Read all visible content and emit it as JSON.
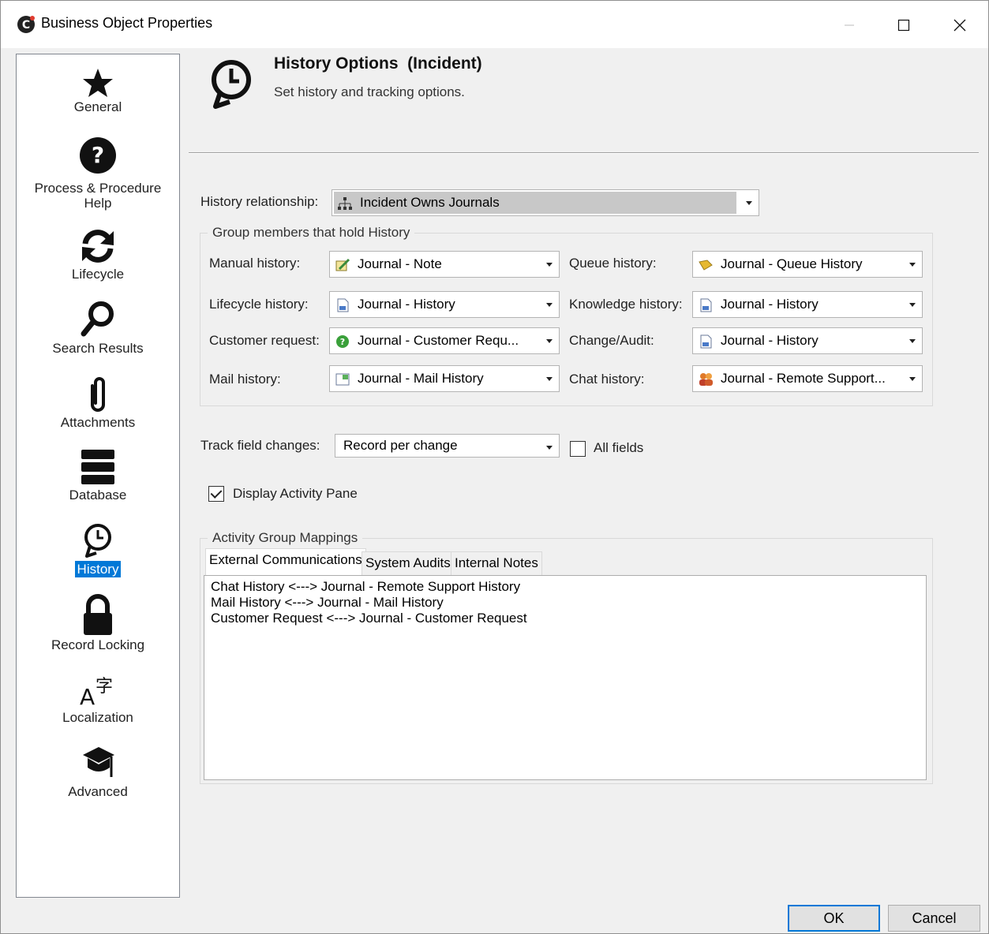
{
  "window": {
    "title": "Business Object Properties",
    "controls": {
      "minimize": "—",
      "maximize": "☐",
      "close": "✕"
    }
  },
  "sidebar": {
    "items": [
      {
        "label": "General",
        "icon": "star-icon",
        "selected": false
      },
      {
        "label": "Process & Procedure",
        "label2": "Help",
        "icon": "question-circle-icon",
        "selected": false
      },
      {
        "label": "Lifecycle",
        "icon": "refresh-icon",
        "selected": false
      },
      {
        "label": "Search Results",
        "icon": "magnifier-icon",
        "selected": false
      },
      {
        "label": "Attachments",
        "icon": "paperclip-icon",
        "selected": false
      },
      {
        "label": "Database",
        "icon": "database-icon",
        "selected": false
      },
      {
        "label": "History",
        "icon": "history-clock-icon",
        "selected": true
      },
      {
        "label": "Record Locking",
        "icon": "padlock-icon",
        "selected": false
      },
      {
        "label": "Localization",
        "icon": "localization-icon",
        "selected": false
      },
      {
        "label": "Advanced",
        "icon": "graduation-cap-icon",
        "selected": false
      }
    ]
  },
  "header": {
    "title": "History Options  (Incident)",
    "subtitle": "Set history and tracking options."
  },
  "history_relationship": {
    "label": "History relationship:",
    "value": "Incident Owns Journals",
    "icon": "relationship-tree-icon"
  },
  "group_members": {
    "title": "Group members that hold History",
    "left": [
      {
        "label": "Manual history:",
        "value": "Journal - Note",
        "icon": "note-pencil-icon"
      },
      {
        "label": "Lifecycle history:",
        "value": "Journal - History",
        "icon": "journal-doc-icon"
      },
      {
        "label": "Customer request:",
        "value": "Journal  -  Customer  Requ...",
        "icon": "green-circle-icon"
      },
      {
        "label": "Mail history:",
        "value": "Journal - Mail History",
        "icon": "mail-doc-icon"
      }
    ],
    "right": [
      {
        "label": "Queue history:",
        "value": "Journal - Queue History",
        "icon": "queue-tag-icon"
      },
      {
        "label": "Knowledge history:",
        "value": "Journal - History",
        "icon": "journal-doc-icon"
      },
      {
        "label": "Change/Audit:",
        "value": "Journal - History",
        "icon": "journal-doc-icon"
      },
      {
        "label": "Chat history:",
        "value": "Journal  -  Remote  Support...",
        "icon": "people-icon"
      }
    ]
  },
  "track_changes": {
    "label": "Track field changes:",
    "value": "Record per change",
    "all_fields_label": "All fields",
    "all_fields_checked": false
  },
  "display_activity_pane": {
    "label": "Display Activity Pane",
    "checked": true
  },
  "activity_mappings": {
    "title": "Activity Group Mappings",
    "tabs": [
      {
        "label": "External Communications",
        "active": true
      },
      {
        "label": "System Audits",
        "active": false
      },
      {
        "label": "Internal Notes",
        "active": false
      }
    ],
    "lines": [
      "Chat History <---> Journal - Remote Support History",
      "Mail History <---> Journal - Mail History",
      "Customer Request <---> Journal - Customer Request"
    ]
  },
  "buttons": {
    "ok": "OK",
    "cancel": "Cancel"
  },
  "colors": {
    "selection": "#0078d7",
    "window_bg": "#f0f0f0"
  }
}
